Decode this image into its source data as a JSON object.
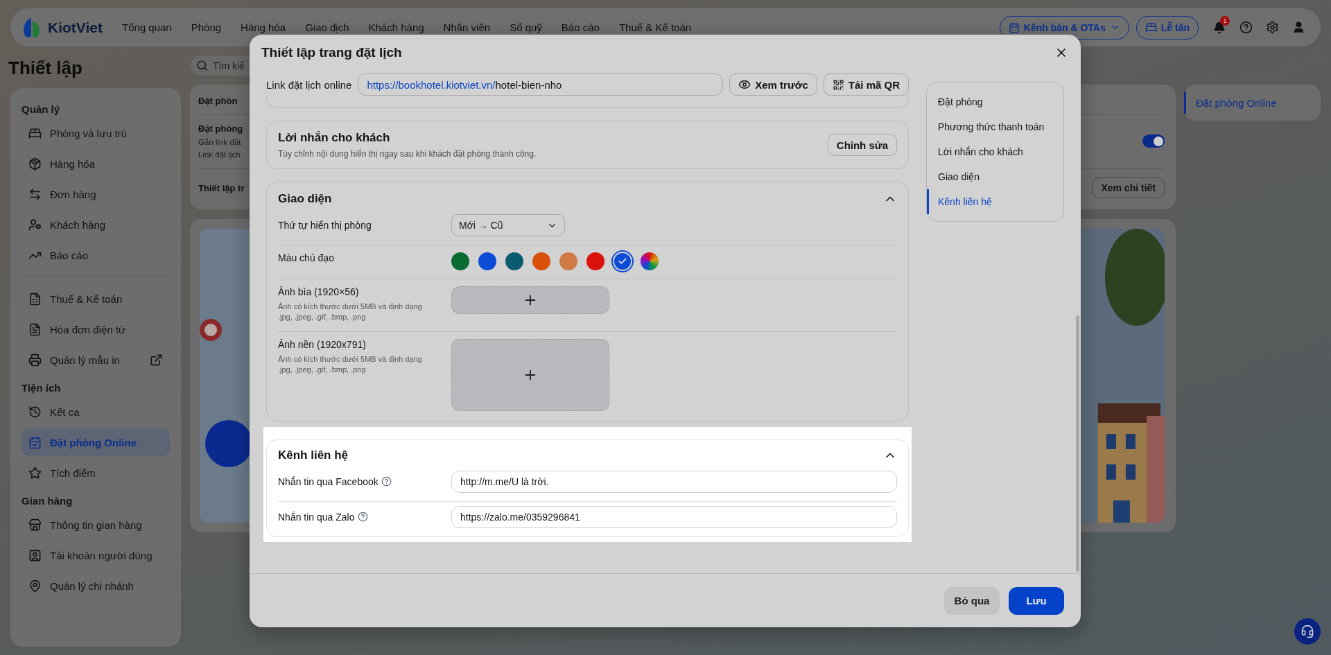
{
  "topbar": {
    "logo": "KiotViet",
    "nav": [
      "Tổng quan",
      "Phòng",
      "Hàng hóa",
      "Giao dịch",
      "Khách hàng",
      "Nhân viên",
      "Sổ quỹ",
      "Báo cáo",
      "Thuế & Kế toán"
    ],
    "channels_button": "Kênh bán & OTAs",
    "reception_button": "Lễ tân",
    "notification_count": "1"
  },
  "page": {
    "title": "Thiết lập",
    "search": {
      "placeholder": "Tìm kiế"
    }
  },
  "sidebar": {
    "sections": [
      {
        "title": "Quản lý",
        "items": [
          {
            "label": "Phòng và lưu trú",
            "selected": false,
            "external": false
          },
          {
            "label": "Hàng hóa",
            "selected": false,
            "external": false
          },
          {
            "label": "Đơn hàng",
            "selected": false,
            "external": false
          },
          {
            "label": "Khách hàng",
            "selected": false,
            "external": false
          },
          {
            "label": "Báo cáo",
            "selected": false,
            "external": false
          }
        ]
      },
      {
        "items": [
          {
            "label": "Thuế & Kế toán",
            "selected": false,
            "external": false
          },
          {
            "label": "Hóa đơn điện tử",
            "selected": false,
            "external": false
          },
          {
            "label": "Quản lý mẫu in",
            "selected": false,
            "external": true
          }
        ]
      },
      {
        "title": "Tiện ích",
        "items": [
          {
            "label": "Kết ca",
            "selected": false,
            "external": false
          },
          {
            "label": "Đặt phòng Online",
            "selected": true,
            "external": false
          },
          {
            "label": "Tích điểm",
            "selected": false,
            "external": false
          }
        ]
      },
      {
        "title": "Gian hàng",
        "items": [
          {
            "label": "Thông tin gian hàng",
            "selected": false,
            "external": false
          },
          {
            "label": "Tài khoản người dùng",
            "selected": false,
            "external": false
          },
          {
            "label": "Quản lý chi nhánh",
            "selected": false,
            "external": false
          }
        ]
      }
    ]
  },
  "background_panel": {
    "card_title": "Đặt phòn",
    "row_title": "Đặt phòng",
    "row_lines": [
      "Gắn link đặt",
      "Link đặt lịch"
    ],
    "toggle_on": true,
    "row2_title": "Thiết lập tr",
    "detail_button": "Xem chi tiết"
  },
  "right_panel": {
    "items": [
      {
        "label": "Đặt phòng Online",
        "selected": true
      }
    ]
  },
  "modal": {
    "title": "Thiết lập trang đặt lịch",
    "link": {
      "label": "Link đặt lịch online",
      "url_base": "https://bookhotel.kiotviet.vn/",
      "url_slug": "hotel-bien-nho",
      "preview_button": "Xem trước",
      "qr_button": "Tải mã QR"
    },
    "message_section": {
      "title": "Lời nhắn cho khách",
      "description": "Tùy chỉnh nội dung hiển thị ngay sau khi khách đặt phòng thành công.",
      "edit_button": "Chỉnh sửa"
    },
    "appearance": {
      "title": "Giao diện",
      "expanded": true,
      "room_order": {
        "label": "Thứ tự hiển thị phòng",
        "value": "Mới → Cũ"
      },
      "theme_color": {
        "label": "Màu chủ đạo",
        "swatches": [
          {
            "kind": "solid",
            "color": "#0a6b32",
            "selected": false
          },
          {
            "kind": "solid",
            "color": "#0b4bd6",
            "selected": false
          },
          {
            "kind": "solid",
            "color": "#0a5a70",
            "selected": false
          },
          {
            "kind": "solid",
            "color": "#d9500a",
            "selected": false
          },
          {
            "kind": "solid",
            "color": "#d07a45",
            "selected": false
          },
          {
            "kind": "solid",
            "color": "#d9120d",
            "selected": false
          },
          {
            "kind": "solid",
            "color": "#0b4bd6",
            "selected": true
          },
          {
            "kind": "custom",
            "selected": false
          }
        ]
      },
      "uploads": [
        {
          "kind": "banner",
          "label": "Ảnh bìa (1920×56)",
          "hint": "Ảnh có kích thước dưới 5MB và định dạng .jpg, .jpeg, .gif, .bmp, .png"
        },
        {
          "kind": "background",
          "label": "Ảnh nền (1920x791)",
          "hint": "Ảnh có kích thước dưới 5MB và định dạng .jpg, .jpeg, .gif, .bmp, .png"
        }
      ]
    },
    "contact": {
      "title": "Kênh liên hệ",
      "expanded": true,
      "highlighted": true,
      "fields": [
        {
          "label": "Nhắn tin qua Facebook",
          "value": "http://m.me/U là trời."
        },
        {
          "label": "Nhắn tin qua Zalo",
          "value": "https://zalo.me/0359296841"
        }
      ]
    },
    "nav": {
      "items": [
        {
          "label": "Đặt phòng",
          "selected": false
        },
        {
          "label": "Phương thức thanh toán",
          "selected": false
        },
        {
          "label": "Lời nhắn cho khách",
          "selected": false
        },
        {
          "label": "Giao diện",
          "selected": false
        },
        {
          "label": "Kênh liên hệ",
          "selected": true
        }
      ]
    },
    "footer": {
      "cancel_button": "Bỏ qua",
      "save_button": "Lưu"
    }
  }
}
